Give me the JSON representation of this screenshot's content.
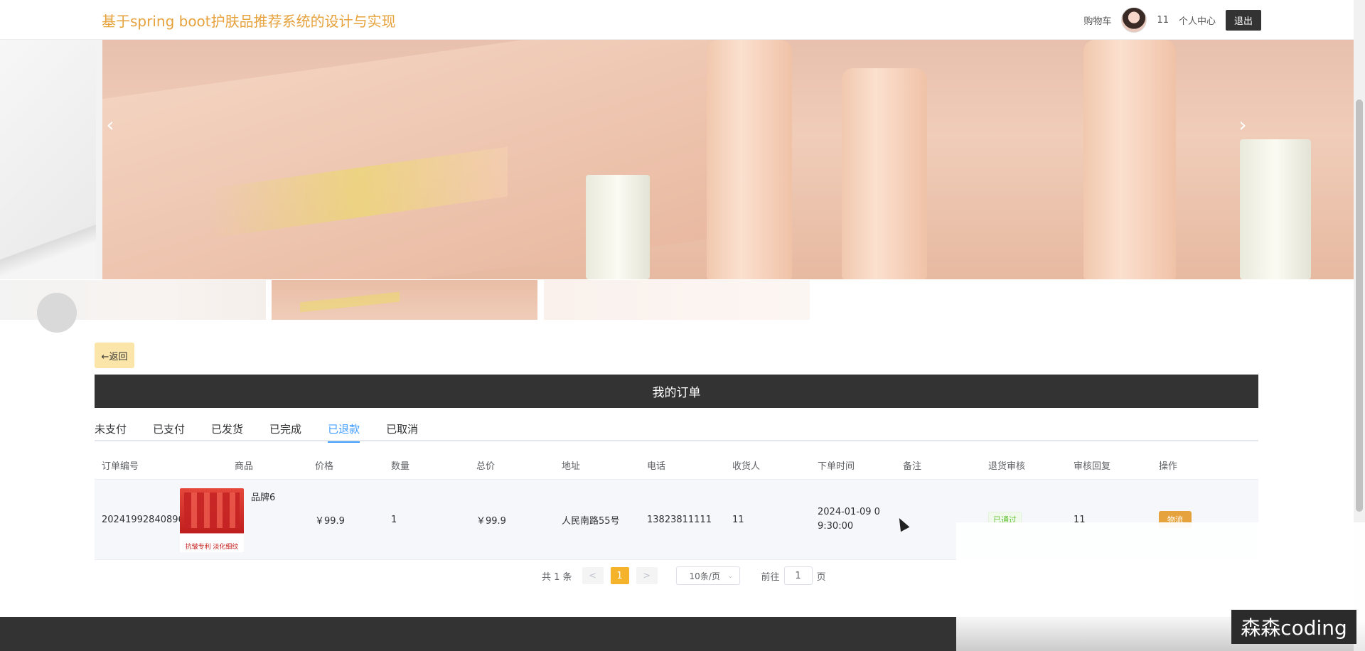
{
  "header": {
    "site_title": "基于spring boot护肤品推荐系统的设计与实现",
    "cart_label": "购物车",
    "username": "11",
    "profile_label": "个人中心",
    "logout_label": "退出"
  },
  "carousel": {
    "prev_icon": "chevron-left-icon",
    "next_icon": "chevron-right-icon",
    "thumbnail_count": 3,
    "active_thumbnail": 2
  },
  "back_button": {
    "label": "←返回"
  },
  "orders": {
    "title": "我的订单",
    "tabs": [
      "未支付",
      "已支付",
      "已发货",
      "已完成",
      "已退款",
      "已取消"
    ],
    "active_tab": "已退款",
    "columns": [
      "订单编号",
      "商品",
      "价格",
      "数量",
      "总价",
      "地址",
      "电话",
      "收货人",
      "下单时间",
      "备注",
      "退货审核",
      "审核回复",
      "操作"
    ],
    "rows": [
      {
        "order_no": "20241992840896",
        "product_name": "品牌6",
        "product_image_caption": "抗皱专利 淡化细纹",
        "price": "￥99.9",
        "quantity": "1",
        "total": "￥99.9",
        "address": "人民南路55号",
        "phone": "13823811111",
        "receiver": "11",
        "order_time": "2024-01-09 09:30:00",
        "remark": "",
        "return_review": "已通过",
        "review_reply": "11",
        "action": "物流"
      }
    ]
  },
  "pagination": {
    "total_text": "共 1 条",
    "prev": "<",
    "current_page": "1",
    "next": ">",
    "page_size": "10条/页",
    "goto_label": "前往",
    "goto_value": "1",
    "page_unit": "页"
  },
  "watermark": {
    "text": "森森coding"
  },
  "colors": {
    "accent": "#e6a23c",
    "active_tab": "#409eff",
    "dark_bar": "#333333",
    "page_active": "#f5b32c"
  }
}
